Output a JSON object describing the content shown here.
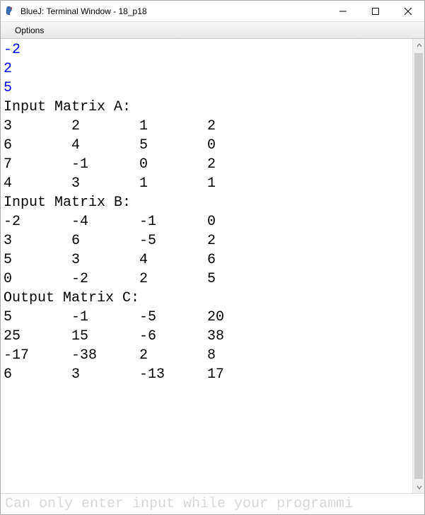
{
  "window": {
    "title": "BlueJ: Terminal Window - 18_p18"
  },
  "menubar": {
    "options_label": "Options"
  },
  "terminal": {
    "input_values": [
      "-2",
      "2",
      "5"
    ],
    "header_a": "Input Matrix A:",
    "matrix_a": [
      [
        "3",
        "2",
        "1",
        "2"
      ],
      [
        "6",
        "4",
        "5",
        "0"
      ],
      [
        "7",
        "-1",
        "0",
        "2"
      ],
      [
        "4",
        "3",
        "1",
        "1"
      ]
    ],
    "header_b": "Input Matrix B:",
    "matrix_b": [
      [
        "-2",
        "-4",
        "-1",
        "0"
      ],
      [
        "3",
        "6",
        "-5",
        "2"
      ],
      [
        "5",
        "3",
        "4",
        "6"
      ],
      [
        "0",
        "-2",
        "2",
        "5"
      ]
    ],
    "header_c": "Output Matrix C:",
    "matrix_c": [
      [
        "5",
        "-1",
        "-5",
        "20"
      ],
      [
        "25",
        "15",
        "-6",
        "38"
      ],
      [
        "-17",
        "-38",
        "2",
        "8"
      ],
      [
        "6",
        "3",
        "-13",
        "17"
      ]
    ]
  },
  "inputbar": {
    "placeholder": "Can only enter input while your programmi"
  }
}
